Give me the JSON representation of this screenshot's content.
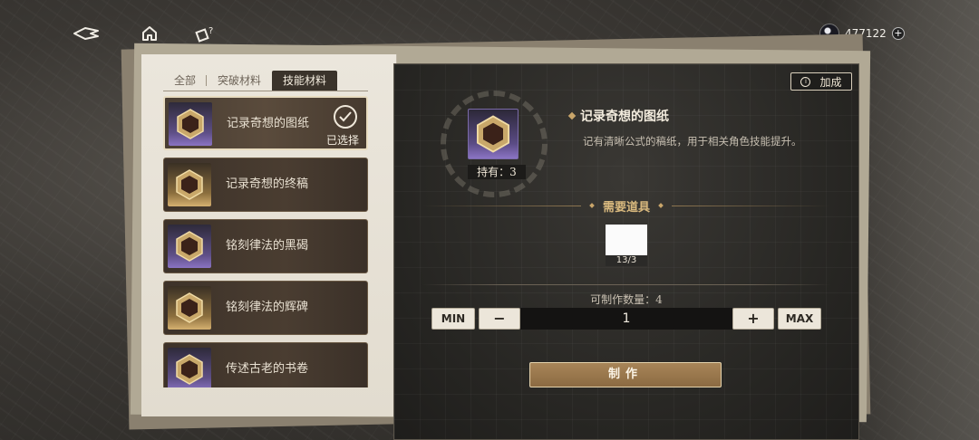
{
  "topbar": {
    "currency_amount": "477122",
    "currency_plus": "+"
  },
  "tabs": [
    {
      "label": "全部",
      "active": false
    },
    {
      "label": "突破材料",
      "active": false
    },
    {
      "label": "技能材料",
      "active": true
    }
  ],
  "items": [
    {
      "label": "记录奇想的图纸",
      "rarity": "purple",
      "selected": true
    },
    {
      "label": "记录奇想的终稿",
      "rarity": "gold",
      "selected": false
    },
    {
      "label": "铭刻律法的黑碣",
      "rarity": "purple",
      "selected": false
    },
    {
      "label": "铭刻律法的辉碑",
      "rarity": "gold",
      "selected": false
    },
    {
      "label": "传述古老的书卷",
      "rarity": "purple",
      "selected": false
    }
  ],
  "selected_label": "已选择",
  "detail": {
    "bonus_label": "加成",
    "held_label": "持有：3",
    "title": "记录奇想的图纸",
    "description": "记有清晰公式的稿纸，用于相关角色技能提升。",
    "required_heading": "需要道具",
    "required_count": "13/3",
    "craftable_label": "可制作数量：4",
    "min_label": "MIN",
    "minus_label": "−",
    "quantity": "1",
    "plus_label": "+",
    "max_label": "MAX",
    "make_label": "制作"
  },
  "colors": {
    "accent_gold": "#c9a56a",
    "rarity_purple": "#8a73c2",
    "rarity_gold": "#d4b070",
    "make_button": "#9b7a4e"
  }
}
